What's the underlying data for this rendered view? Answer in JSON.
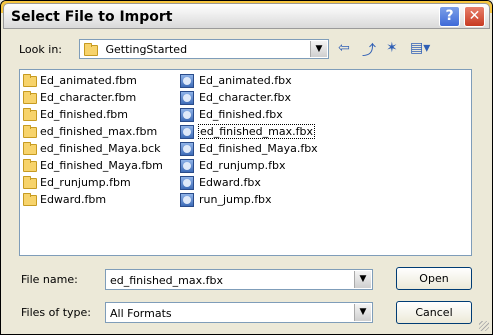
{
  "dialog": {
    "title": "Select File to Import",
    "help_label": "?",
    "close_label": "✕"
  },
  "lookin": {
    "label": "Look in:",
    "value": "GettingStarted"
  },
  "toolbar": {
    "back_icon": "⇦",
    "up_icon": "⤴",
    "newfolder_icon": "✶",
    "views_icon": "▤▾"
  },
  "files": {
    "column1": [
      {
        "name": "Ed_animated.fbm",
        "type": "folder"
      },
      {
        "name": "Ed_character.fbm",
        "type": "folder"
      },
      {
        "name": "Ed_finished.fbm",
        "type": "folder"
      },
      {
        "name": "ed_finished_max.fbm",
        "type": "folder"
      },
      {
        "name": "ed_finished_Maya.bck",
        "type": "folder"
      },
      {
        "name": "Ed_finished_Maya.fbm",
        "type": "folder"
      },
      {
        "name": "Ed_runjump.fbm",
        "type": "folder"
      },
      {
        "name": "Edward.fbm",
        "type": "folder"
      }
    ],
    "column2": [
      {
        "name": "Ed_animated.fbx",
        "type": "fbx"
      },
      {
        "name": "Ed_character.fbx",
        "type": "fbx"
      },
      {
        "name": "Ed_finished.fbx",
        "type": "fbx"
      },
      {
        "name": "ed_finished_max.fbx",
        "type": "fbx",
        "selected": true
      },
      {
        "name": "Ed_finished_Maya.fbx",
        "type": "fbx"
      },
      {
        "name": "Ed_runjump.fbx",
        "type": "fbx"
      },
      {
        "name": "Edward.fbx",
        "type": "fbx"
      },
      {
        "name": "run_jump.fbx",
        "type": "fbx"
      }
    ]
  },
  "form": {
    "filename_label": "File name:",
    "filename_value": "ed_finished_max.fbx",
    "filetype_label": "Files of type:",
    "filetype_value": "All Formats",
    "open_label": "Open",
    "cancel_label": "Cancel"
  }
}
